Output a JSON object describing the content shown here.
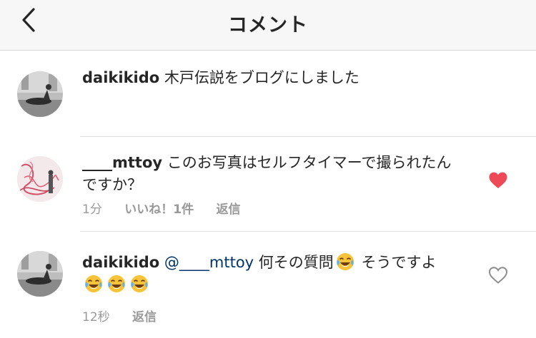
{
  "header": {
    "title": "コメント",
    "back_icon": "chevron-left-icon"
  },
  "comments": [
    {
      "username": "daikikido",
      "body": "木戸伝説をブログにしました",
      "avatar": "avatar-photo"
    },
    {
      "username": "____mttoy",
      "body": "このお写真はセルフタイマーで撮られたんですか？",
      "time": "1分",
      "likes": "いいね！1件",
      "reply": "返信",
      "liked": true,
      "heart_color": "#ed4956",
      "avatar": "avatar-photo"
    },
    {
      "username": "daikikido",
      "mention": "@____mttoy",
      "body_before_emoji": "何その質問",
      "body_after_emoji": "そうですよ",
      "emoji": "face-with-tears-of-joy",
      "time": "12秒",
      "reply": "返信",
      "liked": false,
      "avatar": "avatar-photo"
    }
  ]
}
